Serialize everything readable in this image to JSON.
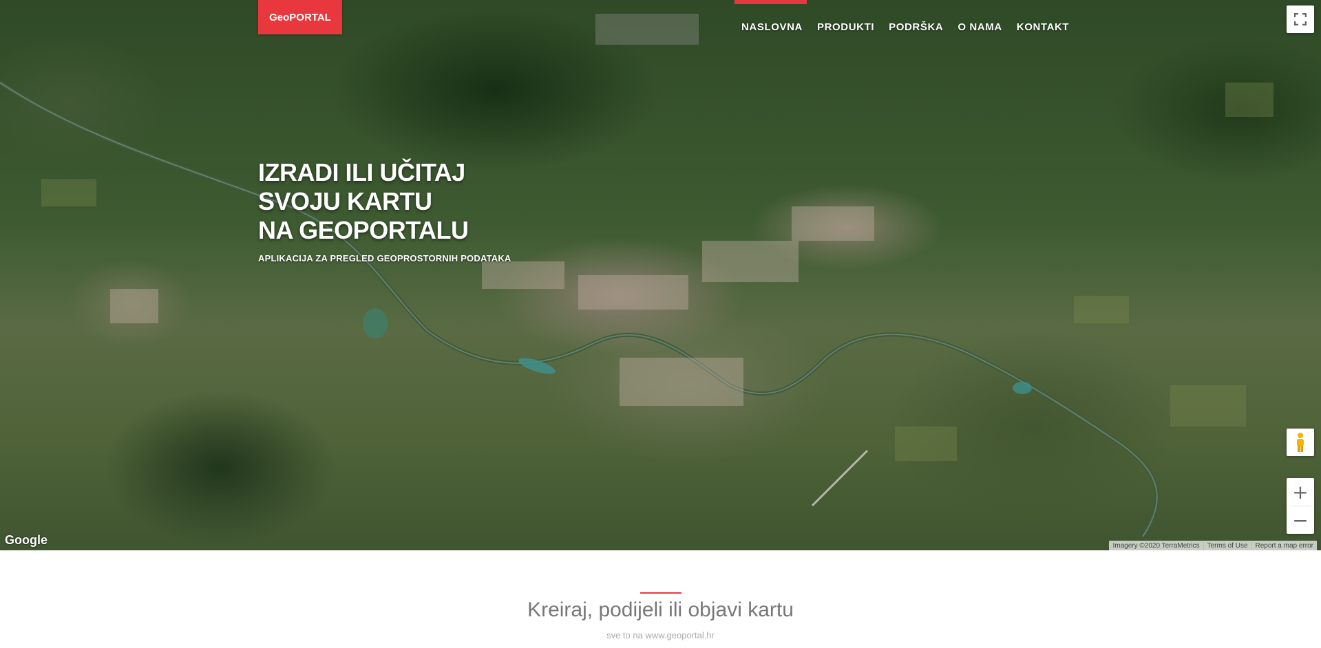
{
  "brand": {
    "label": "GeoPORTAL",
    "color": "#e8383d"
  },
  "nav": {
    "items": [
      {
        "label": "NASLOVNA"
      },
      {
        "label": "PRODUKTI"
      },
      {
        "label": "PODRŠKA"
      },
      {
        "label": "O NAMA"
      },
      {
        "label": "KONTAKT"
      }
    ],
    "active_index": 0
  },
  "hero": {
    "title_lines": [
      "IZRADI ILI UČITAJ",
      "SVOJU KARTU",
      "NA GEOPORTALU"
    ],
    "subtitle": "APLIKACIJA ZA PREGLED GEOPROSTORNIH PODATAKA"
  },
  "map": {
    "controls": {
      "fullscreen_icon": "fullscreen-icon",
      "pegman_icon": "street-view-pegman-icon",
      "zoom_in": "+",
      "zoom_out": "−"
    },
    "logo": "Google",
    "attribution": {
      "imagery": "Imagery ©2020 TerraMetrics",
      "terms": "Terms of Use",
      "report": "Report a map error"
    }
  },
  "section": {
    "title": "Kreiraj, podijeli ili objavi kartu",
    "subtitle": "sve to na www.geoportal.hr"
  }
}
